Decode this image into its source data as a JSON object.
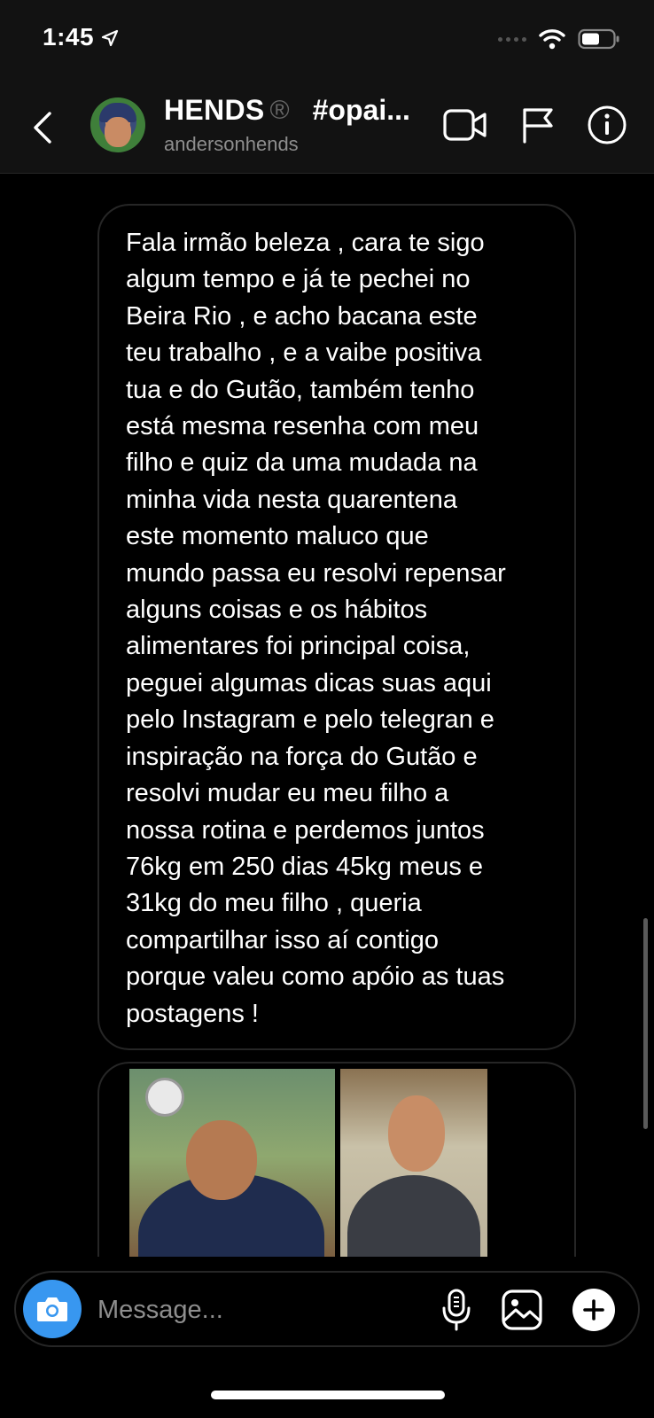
{
  "status_bar": {
    "time": "1:45",
    "icons": [
      "location-arrow-icon",
      "signal-icon",
      "wifi-icon",
      "battery-icon"
    ]
  },
  "header": {
    "name": "HENDS",
    "registered_mark": "®",
    "hashtag": "#opai...",
    "username": "andersonhends",
    "icons": [
      "back-icon",
      "video-call-icon",
      "flag-icon",
      "info-icon"
    ]
  },
  "messages": [
    {
      "type": "text",
      "text": "Fala irmão beleza , cara te sigo\nalgum tempo e já te pechei no\nBeira Rio , e acho bacana este\nteu trabalho , e a  vaibe positiva\ntua e do Gutão,  também tenho\nestá mesma resenha com meu\nfilho e quiz da uma mudada na\nminha vida nesta quarentena\neste momento maluco que\nmundo passa eu resolvi repensar\nalguns coisas e os  hábitos\nalimentares foi principal coisa,\npeguei algumas dicas suas aqui\npelo Instagram e pelo telegran e\ninspiração na força do Gutão e\nresolvi mudar eu meu filho a\nnossa rotina e perdemos juntos\n76kg em 250 dias 45kg meus e\n31kg do meu filho , queria\ncompartilhar isso aí contigo\nporque valeu como apóio as tuas\npostagens !"
    },
    {
      "type": "photo",
      "images": [
        "before-photo",
        "after-photo"
      ]
    }
  ],
  "composer": {
    "placeholder": "Message...",
    "value": "",
    "icons": [
      "camera-icon",
      "microphone-icon",
      "gallery-icon",
      "plus-icon"
    ]
  },
  "colors": {
    "background": "#000000",
    "header_bg": "#121212",
    "bubble_border": "#262626",
    "camera_button": "#3897f0",
    "secondary_text": "#8e8e8e"
  }
}
